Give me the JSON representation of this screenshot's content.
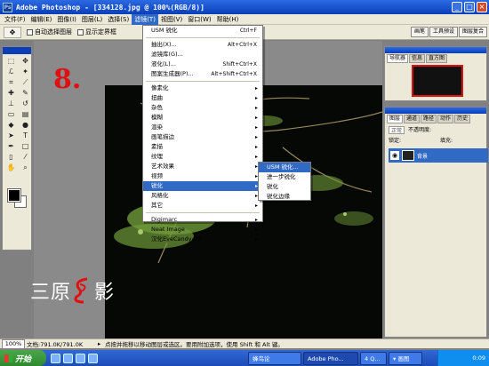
{
  "titlebar": {
    "title": "Adobe Photoshop - [334128.jpg @ 100%(RGB/8)]",
    "min": "_",
    "max": "□",
    "close": "×"
  },
  "menubar": {
    "items": [
      "文件(F)",
      "编辑(E)",
      "图像(I)",
      "图层(L)",
      "选择(S)",
      "滤镜(T)",
      "视图(V)",
      "窗口(W)",
      "帮助(H)"
    ]
  },
  "options": {
    "auto_select": "自动选择图层",
    "show_bounds": "显示定界框",
    "tabs": [
      "画笔",
      "工具预设",
      "图层复合"
    ]
  },
  "step_label": "8.",
  "watermark": {
    "left": "三原",
    "right": "影"
  },
  "filter_menu": {
    "items": [
      {
        "label": "USM 锐化",
        "shortcut": "Ctrl+F"
      },
      {
        "sep": true
      },
      {
        "label": "抽出(X)...",
        "shortcut": "Alt+Ctrl+X"
      },
      {
        "label": "滤镜库(G)..."
      },
      {
        "label": "液化(L)...",
        "shortcut": "Shift+Ctrl+X"
      },
      {
        "label": "图案生成器(P)...",
        "shortcut": "Alt+Shift+Ctrl+X"
      },
      {
        "sep": true
      },
      {
        "label": "像素化",
        "arrow": "▸"
      },
      {
        "label": "扭曲",
        "arrow": "▸"
      },
      {
        "label": "杂色",
        "arrow": "▸"
      },
      {
        "label": "模糊",
        "arrow": "▸"
      },
      {
        "label": "渲染",
        "arrow": "▸"
      },
      {
        "label": "画笔描边",
        "arrow": "▸"
      },
      {
        "label": "素描",
        "arrow": "▸"
      },
      {
        "label": "纹理",
        "arrow": "▸"
      },
      {
        "label": "艺术效果",
        "arrow": "▸"
      },
      {
        "label": "视频",
        "arrow": "▸"
      },
      {
        "label": "锐化",
        "arrow": "▸",
        "hl": true
      },
      {
        "label": "风格化",
        "arrow": "▸"
      },
      {
        "label": "其它",
        "arrow": "▸"
      },
      {
        "sep": true
      },
      {
        "label": "Digimarc",
        "arrow": "▸"
      },
      {
        "label": "Neat Image",
        "arrow": "▸"
      },
      {
        "label": "汉化EyeCandy4.0",
        "arrow": "▸"
      }
    ]
  },
  "sharpen_submenu": {
    "items": [
      "USM 锐化...",
      "进一步锐化",
      "锐化",
      "锐化边缘"
    ]
  },
  "navigator": {
    "tabs": [
      "导航器",
      "信息",
      "直方图"
    ]
  },
  "layers": {
    "tabs": [
      "图层",
      "通道",
      "路径",
      "动作",
      "历史"
    ],
    "blend_mode": "正常",
    "opacity_label": "不透明度:",
    "lock_label": "锁定:",
    "fill_label": "填充:",
    "layer_name": "背景"
  },
  "statusbar": {
    "zoom": "100%",
    "doc": "文档:791.0K/791.0K",
    "arrow": "▸",
    "hint": "点按并拖移以移动图层或选区。要用附加选项，使用 Shift 和 Alt 键。"
  },
  "taskbar": {
    "start": "开始",
    "tasks": [
      "蜂鸟论",
      "Adobe Pho...",
      "4 Q...",
      "▾ 画图"
    ],
    "time": "0:09"
  }
}
